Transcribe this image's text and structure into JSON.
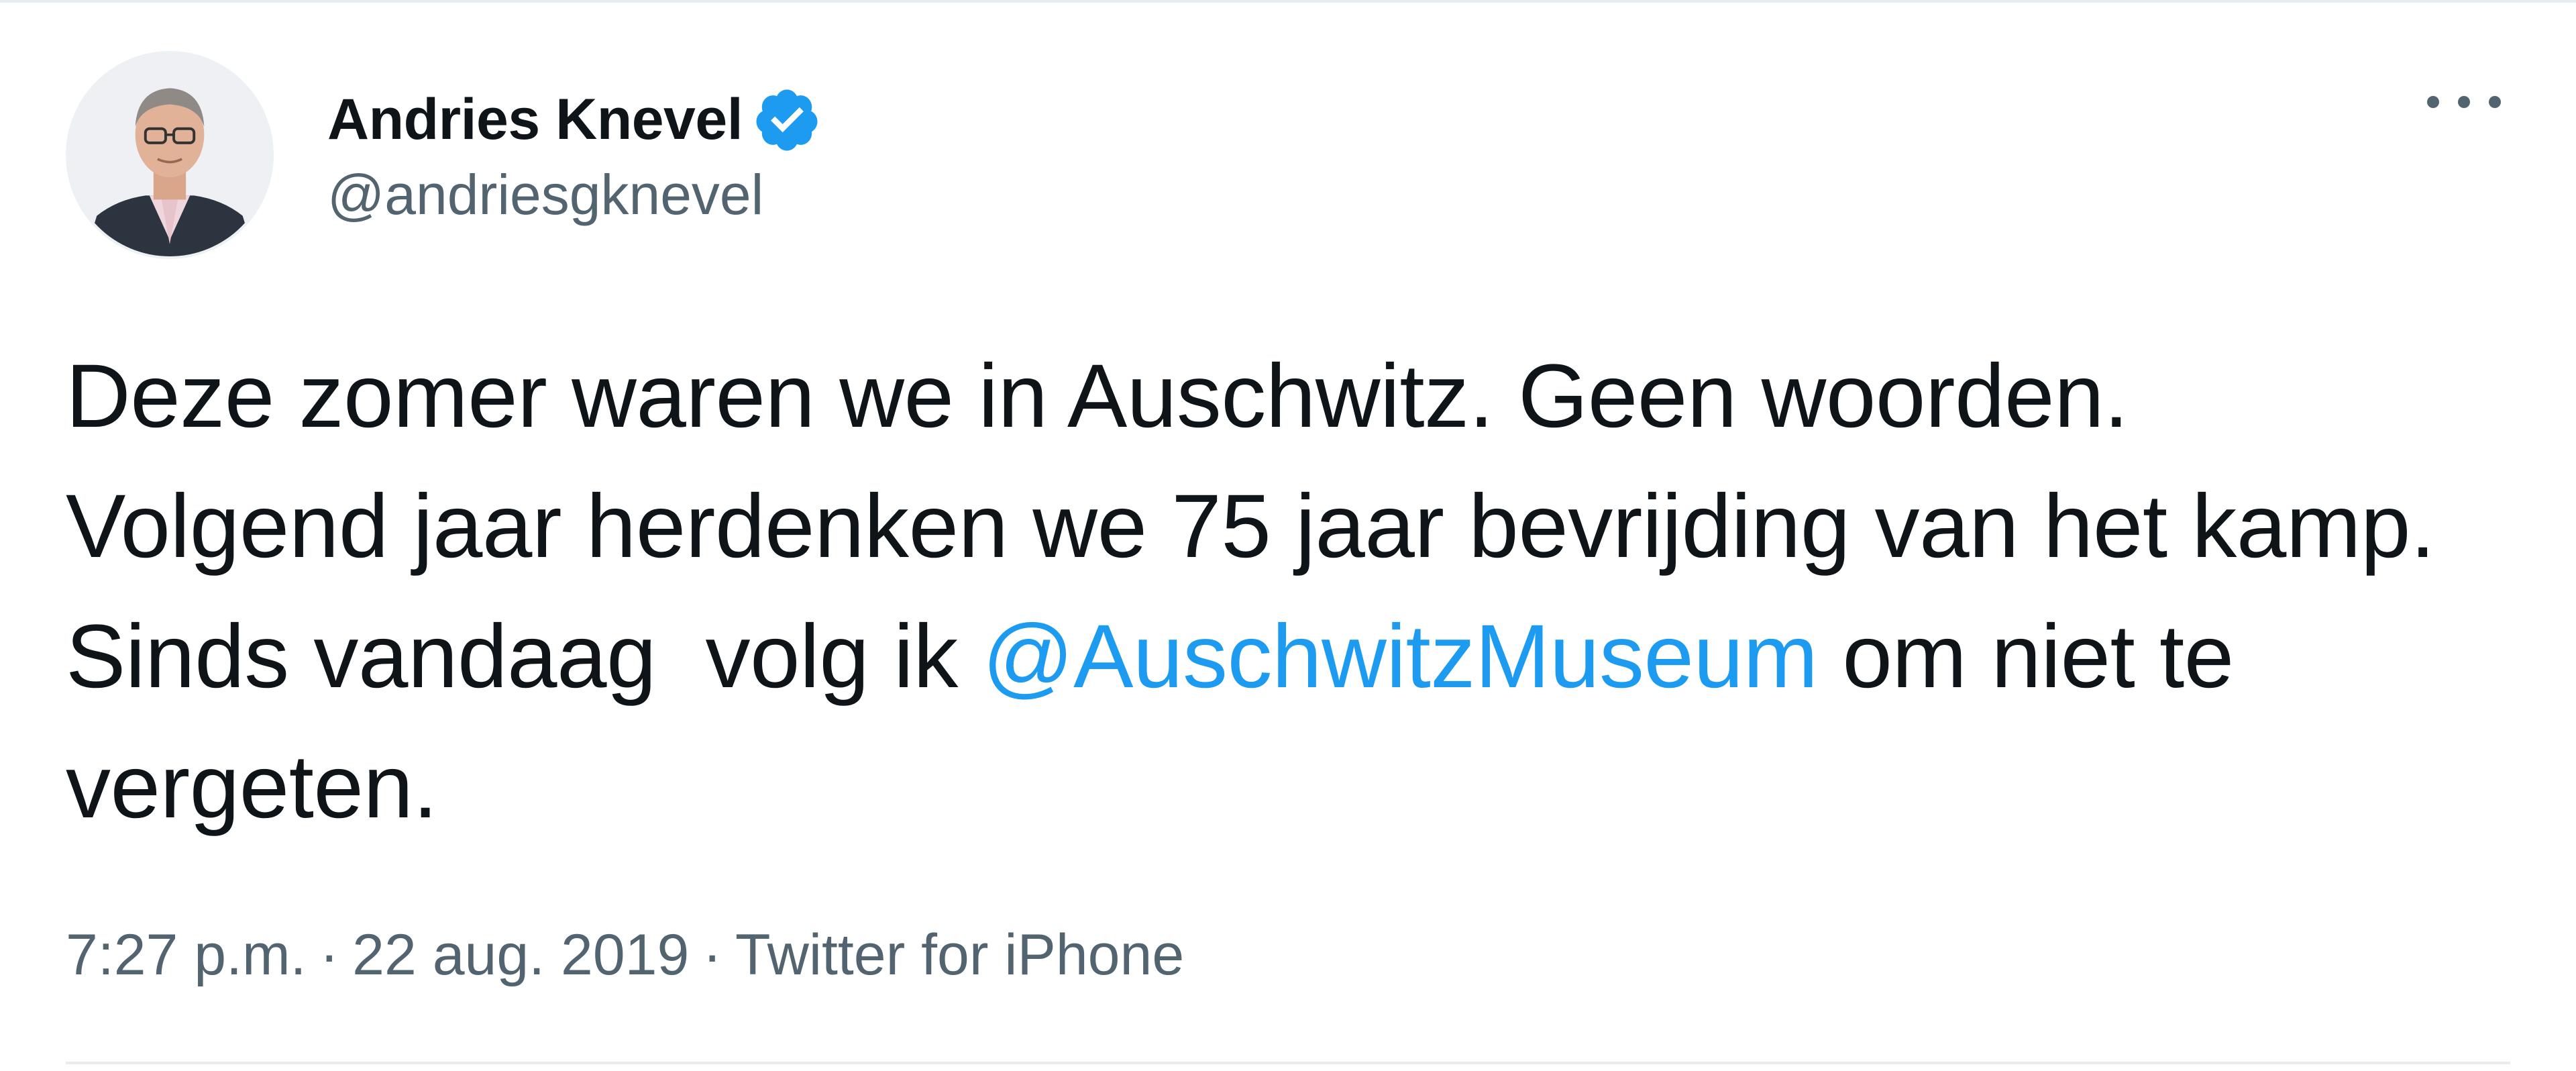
{
  "tweet": {
    "author": {
      "display_name": "Andries Knevel",
      "handle": "@andriesgknevel",
      "verified": true,
      "avatar_icon": "profile-photo"
    },
    "text": {
      "part1": "Deze zomer waren we in Auschwitz. Geen woorden. Volgend jaar herdenken we 75 jaar bevrijding van het kamp. Sinds vandaag  volg ik ",
      "mention": "@AuschwitzMuseum",
      "part2": " om niet te vergeten."
    },
    "meta": {
      "time": "7:27 p.m.",
      "separator": "·",
      "date": "22 aug. 2019",
      "source": "Twitter for iPhone"
    },
    "colors": {
      "accent": "#1d9bf0",
      "text": "#0f1419",
      "secondary": "#536471"
    },
    "icons": {
      "verified": "verified-badge-icon",
      "more": "more-options-icon"
    }
  }
}
